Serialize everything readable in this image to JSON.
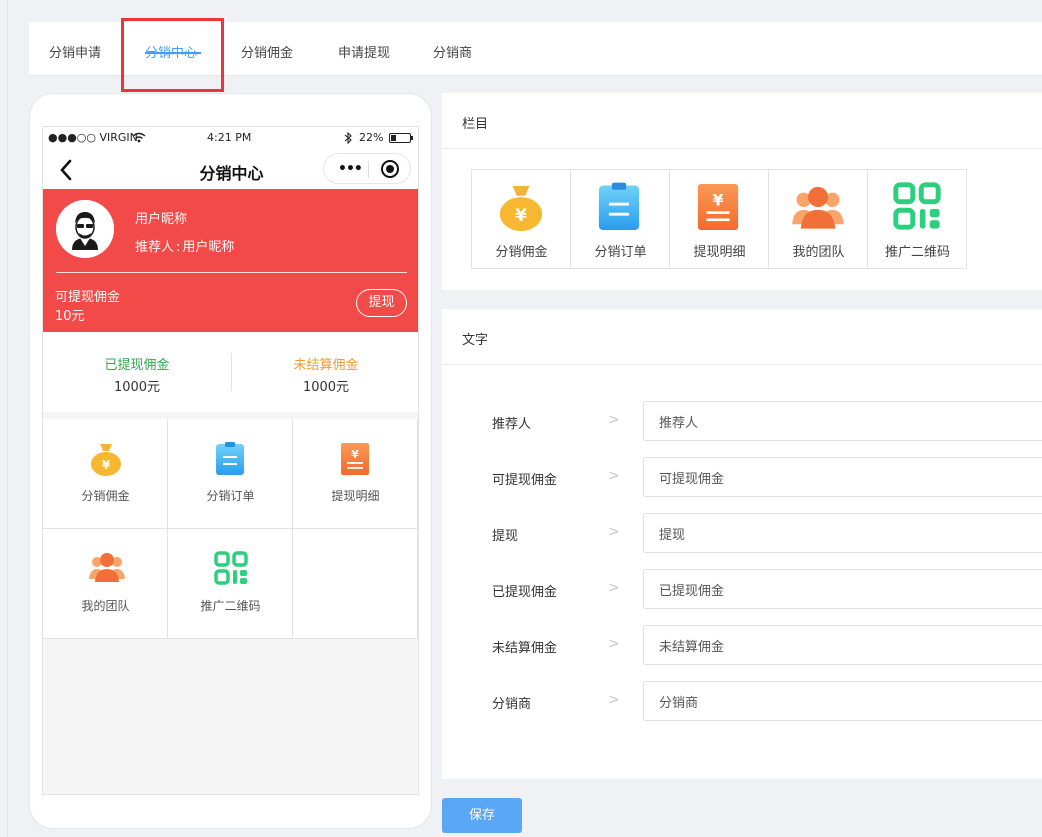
{
  "tabs": [
    {
      "label": "分销申请"
    },
    {
      "label": "分销中心"
    },
    {
      "label": "分销佣金"
    },
    {
      "label": "申请提现"
    },
    {
      "label": "分销商"
    }
  ],
  "active_tab": "分销中心",
  "highlight_color": "#e8373b",
  "accent_color": "#409eff",
  "phone": {
    "status": {
      "carrier": "●●●○○ VIRGIN",
      "time": "4:21 PM",
      "battery": "22%"
    },
    "nav_title": "分销中心",
    "nickname": "用户昵称",
    "referrer_label": "推荐人",
    "referrer_value": "用户昵称",
    "withdrawable_label": "可提现佣金",
    "withdrawable_amount": "10元",
    "withdraw_button": "提现",
    "withdrawn_label": "已提现佣金",
    "withdrawn_value": "1000元",
    "unsettled_label": "未结算佣金",
    "unsettled_value": "1000元",
    "grid": [
      {
        "label": "分销佣金",
        "icon": "money-bag-icon"
      },
      {
        "label": "分销订单",
        "icon": "order-clipboard-icon"
      },
      {
        "label": "提现明细",
        "icon": "withdraw-detail-icon"
      },
      {
        "label": "我的团队",
        "icon": "team-icon"
      },
      {
        "label": "推广二维码",
        "icon": "qr-code-icon"
      }
    ],
    "header_color": "#f24a48",
    "withdrawn_color": "#2fa84f",
    "unsettled_color": "#f29a2e"
  },
  "columns_section": {
    "title": "栏目",
    "items": [
      {
        "label": "分销佣金",
        "icon": "money-bag-icon"
      },
      {
        "label": "分销订单",
        "icon": "order-clipboard-icon"
      },
      {
        "label": "提现明细",
        "icon": "withdraw-detail-icon"
      },
      {
        "label": "我的团队",
        "icon": "team-icon"
      },
      {
        "label": "推广二维码",
        "icon": "qr-code-icon"
      }
    ]
  },
  "text_section": {
    "title": "文字",
    "fields": [
      {
        "label": "推荐人",
        "value": "推荐人"
      },
      {
        "label": "可提现佣金",
        "value": "可提现佣金"
      },
      {
        "label": "提现",
        "value": "提现"
      },
      {
        "label": "已提现佣金",
        "value": "已提现佣金"
      },
      {
        "label": "未结算佣金",
        "value": "未结算佣金"
      },
      {
        "label": "分销商",
        "value": "分销商"
      }
    ]
  },
  "save_button": "保存"
}
